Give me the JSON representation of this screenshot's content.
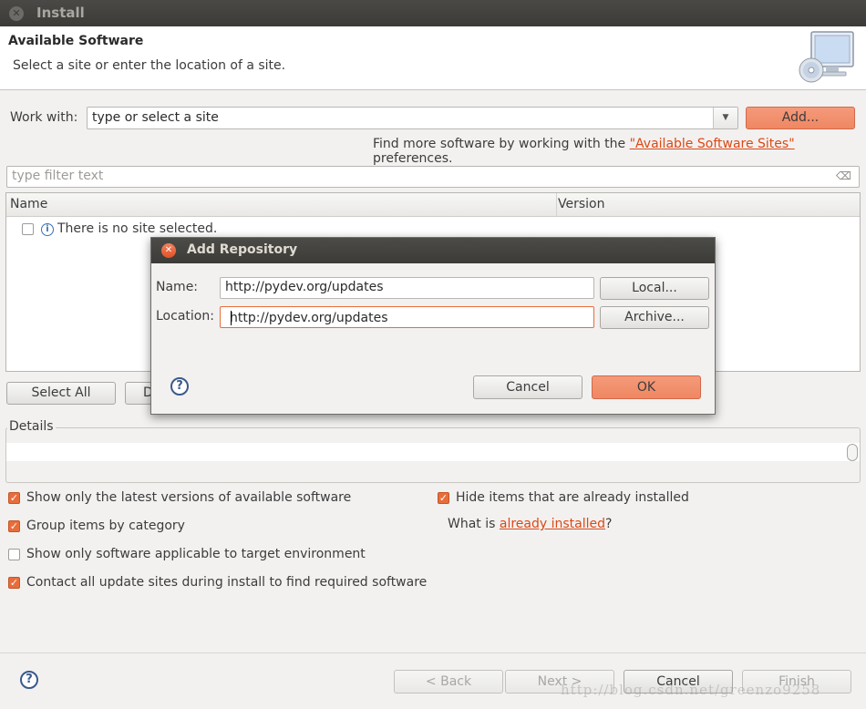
{
  "window": {
    "title": "Install"
  },
  "header": {
    "title": "Available Software",
    "subtitle": "Select a site or enter the location of a site."
  },
  "work_with": {
    "label": "Work with:",
    "value": "type or select a site",
    "add_label": "Add...",
    "find_more_prefix": "Find more software by working with the ",
    "find_more_link": "\"Available Software Sites\"",
    "find_more_suffix": " preferences."
  },
  "filter": {
    "placeholder": "type filter text"
  },
  "table": {
    "columns": [
      "Name",
      "Version"
    ],
    "empty_message": "There is no site selected."
  },
  "buttons": {
    "select_all": "Select All",
    "deselect_all_partial": "D"
  },
  "details": {
    "label": "Details"
  },
  "options": {
    "latest_versions": {
      "label": "Show only the latest versions of available software",
      "checked": true
    },
    "group_by_category": {
      "label": "Group items by category",
      "checked": true
    },
    "target_env": {
      "label": "Show only software applicable to target environment",
      "checked": false
    },
    "contact_sites": {
      "label": "Contact all update sites during install to find required software",
      "checked": true
    },
    "hide_installed": {
      "label": "Hide items that are already installed",
      "checked": true
    },
    "what_is_prefix": "What is ",
    "what_is_link": "already installed",
    "what_is_suffix": "?"
  },
  "footer": {
    "back": "< Back",
    "next": "Next >",
    "cancel": "Cancel",
    "finish": "Finish"
  },
  "dialog": {
    "title": "Add Repository",
    "name_label": "Name:",
    "name_value": "http://pydev.org/updates",
    "location_label": "Location:",
    "location_value": "http://pydev.org/updates",
    "local_button": "Local...",
    "archive_button": "Archive...",
    "cancel_button": "Cancel",
    "ok_button": "OK"
  },
  "watermark": "http://blog.csdn.net/greenzo9258",
  "colors": {
    "accent": "#e86d3a",
    "link": "#dd4814",
    "titlebar": "#3c3b37"
  }
}
